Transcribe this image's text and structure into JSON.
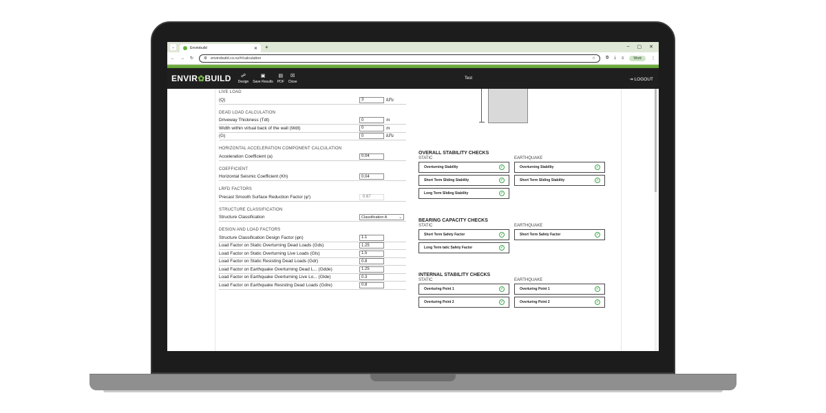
{
  "browser": {
    "tab_title": "Envirobuild",
    "url": "envirobuild.co.nz/#/calculation",
    "profile": "Work"
  },
  "app": {
    "logo_left": "ENVIR",
    "logo_right": "BUILD",
    "title": "Test",
    "logout": "LOGOUT",
    "tools": [
      {
        "label": "Design",
        "icon": "people-icon"
      },
      {
        "label": "Save Results",
        "icon": "save-icon"
      },
      {
        "label": "PDF",
        "icon": "pdf-icon"
      },
      {
        "label": "Close",
        "icon": "close-icon"
      }
    ]
  },
  "form": {
    "live_load": {
      "title": "LIVE LOAD",
      "row_label": "(Q)",
      "value": "3",
      "unit": "kPa"
    },
    "dead_load": {
      "title": "DEAD LOAD CALCULATION",
      "rows": [
        {
          "label": "Driveway Thickness (Tdt)",
          "value": "0",
          "unit": "m"
        },
        {
          "label": "Width within virtual back of the wall (Wdt)",
          "value": "0",
          "unit": "m"
        },
        {
          "label": "(G)",
          "value": "0",
          "unit": "kPa"
        }
      ]
    },
    "horizontal": {
      "title": "HORIZONTAL ACCELERATION COMPONENT CALCULATION",
      "label": "Acceleration Coefficient (a)",
      "value": "0.04"
    },
    "coefficient": {
      "title": "COEFFICIENT",
      "label": "Horizontal Seismic Coefficient (Kh)",
      "value": "0.04"
    },
    "lrfd": {
      "title": "LRFD FACTORS",
      "label": "Precast Smooth Surface Reduction Factor (φ')",
      "value": "0.67"
    },
    "structure": {
      "title": "STRUCTURE CLASSIFICATION",
      "label": "Structure Classification",
      "value": "Classification A"
    },
    "design_factors": {
      "title": "DESIGN AND LOAD FACTORS",
      "rows": [
        {
          "label": "Structure Classification Design Factor (φn)",
          "value": "1.1"
        },
        {
          "label": "Load Factor on Static Overturning Dead Loads (Gds)",
          "value": "1.25"
        },
        {
          "label": "Load Factor on Static Overturning Live Loads (Gls)",
          "value": "1.5"
        },
        {
          "label": "Load Factor on Static Resisting Dead Loads (Gdr)",
          "value": "0.8"
        },
        {
          "label": "Load Factor on Earthquake Overturning Dead L... (Gdde)",
          "value": "1.25"
        },
        {
          "label": "Load Factor on Earthquake Overturning Live Lo... (Glde)",
          "value": "0.3"
        },
        {
          "label": "Load Factor on Earthquake Resisting Dead Loads (Gdre)",
          "value": "0.8"
        }
      ]
    }
  },
  "checks": {
    "overall": {
      "title": "OVERALL STABILITY CHECKS",
      "static_label": "STATIC",
      "earthquake_label": "EARTHQUAKE",
      "static": [
        "Overturning Stability",
        "Short Term Sliding Stability",
        "Long Term Sliding Stability"
      ],
      "earthquake": [
        "Overturning Stability",
        "Short Term Sliding Stability"
      ]
    },
    "bearing": {
      "title": "BEARING CAPACITY CHECKS",
      "static_label": "STATIC",
      "earthquake_label": "EARTHQUAKE",
      "static": [
        "Short Term Safety Factor",
        "Long Term tatic Safety Factor"
      ],
      "earthquake": [
        "Short Term Safety Factor"
      ]
    },
    "internal": {
      "title": "INTERNAL STABILITY CHECKS",
      "static_label": "STATIC",
      "earthquake_label": "EARTHQUAKE",
      "static": [
        "Overturing Point 1",
        "Overturing Point 2"
      ],
      "earthquake": [
        "Overturing Point 1",
        "Overturing Point 2"
      ]
    }
  },
  "colors": {
    "accent": "#7ab648",
    "header": "#1f1f1f",
    "ok": "#3aa648"
  }
}
